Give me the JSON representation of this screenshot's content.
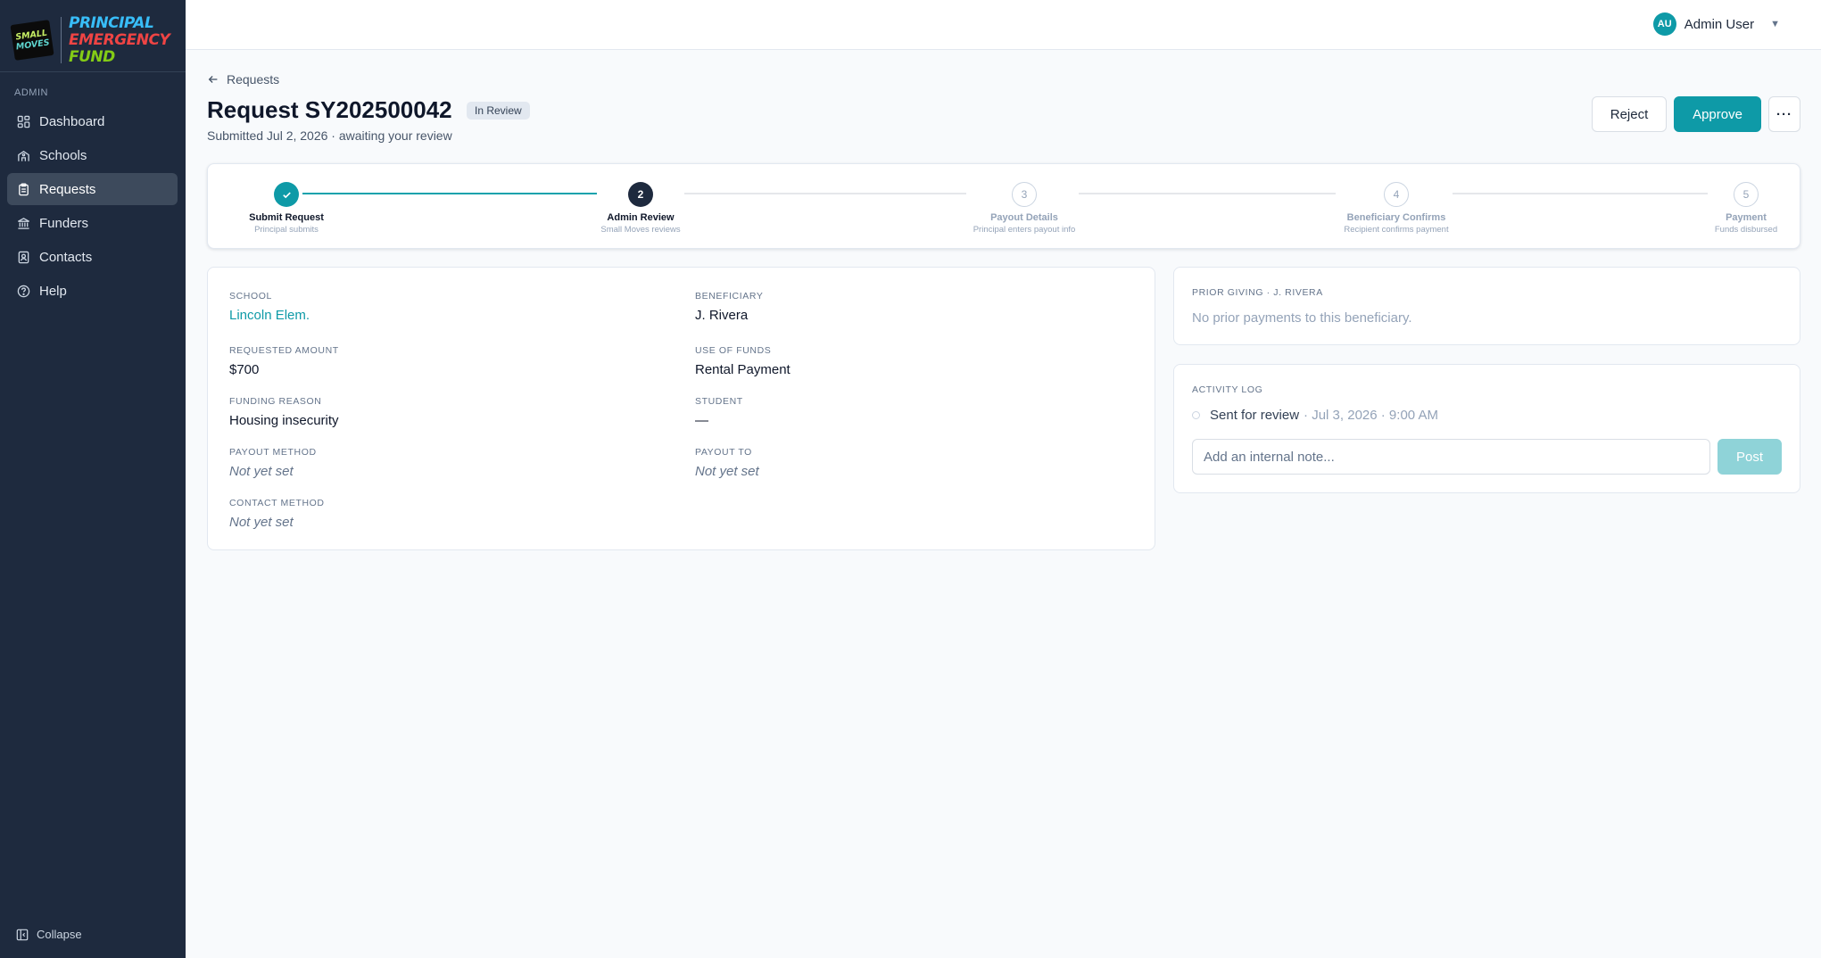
{
  "sidebar": {
    "logo": {
      "badge_line1": "SMALL",
      "badge_line2": "MOVES",
      "text_line1": "PRINCIPAL",
      "text_line2": "EMERGENCY",
      "text_line3": "FUND"
    },
    "section_label": "ADMIN",
    "items": [
      {
        "label": "Dashboard",
        "icon": "dashboard-icon"
      },
      {
        "label": "Schools",
        "icon": "school-icon"
      },
      {
        "label": "Requests",
        "icon": "clipboard-icon",
        "active": true
      },
      {
        "label": "Funders",
        "icon": "bank-icon"
      },
      {
        "label": "Contacts",
        "icon": "contact-book-icon"
      },
      {
        "label": "Help",
        "icon": "help-circle-icon"
      }
    ],
    "collapse_label": "Collapse"
  },
  "topbar": {
    "user_initials": "AU",
    "user_name": "Admin User",
    "caret": "▼"
  },
  "header": {
    "back_label": "Requests",
    "title": "Request SY202500042",
    "status": "In Review",
    "subtitle": "Submitted Jul 2, 2026 · awaiting your review",
    "reject_label": "Reject",
    "approve_label": "Approve",
    "more_label": "···"
  },
  "stepper": {
    "steps": [
      {
        "number": "1",
        "label": "Submit Request",
        "sub": "Principal submits",
        "state": "done"
      },
      {
        "number": "2",
        "label": "Admin Review",
        "sub": "Small Moves reviews",
        "state": "current"
      },
      {
        "number": "3",
        "label": "Payout Details",
        "sub": "Principal enters payout info",
        "state": "pending"
      },
      {
        "number": "4",
        "label": "Beneficiary Confirms",
        "sub": "Recipient confirms payment",
        "state": "pending"
      },
      {
        "number": "5",
        "label": "Payment",
        "sub": "Funds disbursed",
        "state": "pending"
      }
    ]
  },
  "details": {
    "school": {
      "label": "SCHOOL",
      "value": "Lincoln Elem."
    },
    "beneficiary": {
      "label": "BENEFICIARY",
      "value": "J. Rivera"
    },
    "requested_amount": {
      "label": "REQUESTED AMOUNT",
      "value": "$700"
    },
    "use_of_funds": {
      "label": "USE OF FUNDS",
      "value": "Rental Payment"
    },
    "funding_reason": {
      "label": "FUNDING REASON",
      "value": "Housing insecurity"
    },
    "student": {
      "label": "STUDENT",
      "value": "—"
    },
    "payout_method": {
      "label": "PAYOUT METHOD",
      "value": "Not yet set"
    },
    "payout_to": {
      "label": "PAYOUT TO",
      "value": "Not yet set"
    },
    "contact_method": {
      "label": "CONTACT METHOD",
      "value": "Not yet set"
    }
  },
  "prior_giving": {
    "title": "PRIOR GIVING · J. RIVERA",
    "empty_text": "No prior payments to this beneficiary."
  },
  "activity": {
    "title": "ACTIVITY LOG",
    "entries": [
      {
        "text": "Sent for review",
        "time": "· Jul 3, 2026 · 9:00 AM"
      }
    ],
    "note_placeholder": "Add an internal note...",
    "post_label": "Post"
  },
  "colors": {
    "sidebar_bg": "#1e2a3e",
    "accent": "#0e9aa7",
    "accent_disabled": "#8fd3d8",
    "page_bg": "#f8fafc"
  }
}
